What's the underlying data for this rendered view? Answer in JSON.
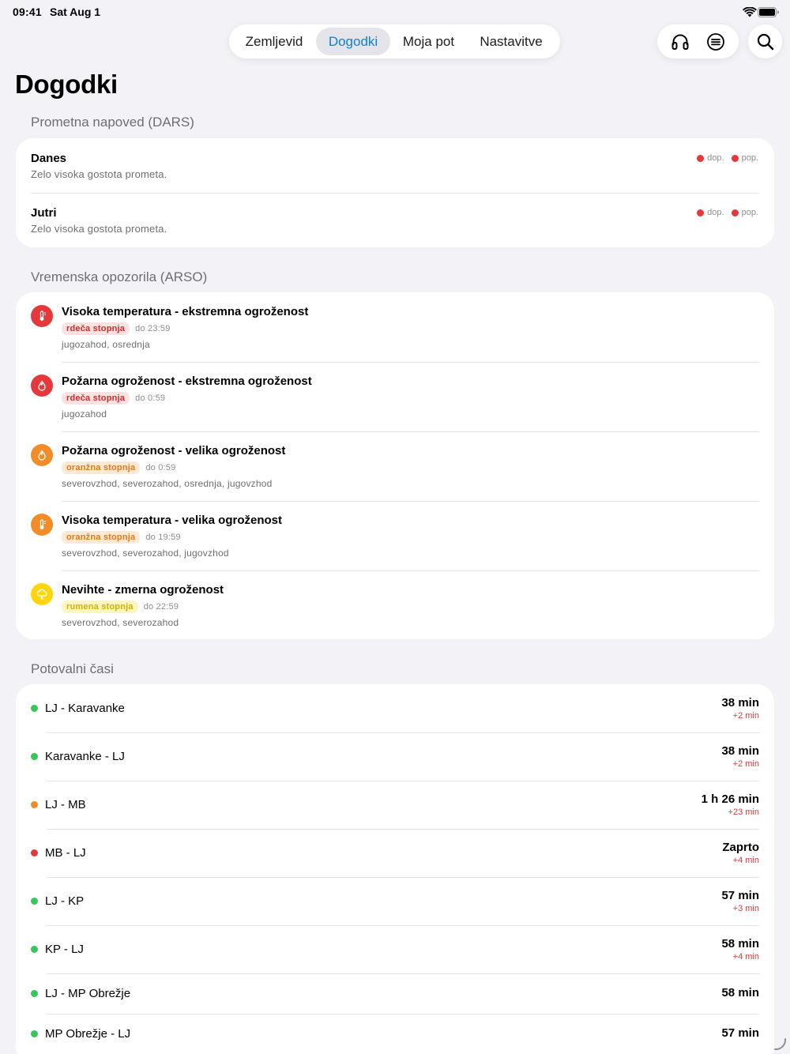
{
  "status_bar": {
    "time": "09:41",
    "date": "Sat Aug 1"
  },
  "nav": {
    "tabs": [
      {
        "label": "Zemljevid",
        "selected": false
      },
      {
        "label": "Dogodki",
        "selected": true
      },
      {
        "label": "Moja pot",
        "selected": false
      },
      {
        "label": "Nastavitve",
        "selected": false
      }
    ],
    "actions": [
      "headphones-icon",
      "list-icon",
      "search-icon"
    ]
  },
  "page": {
    "title": "Dogodki"
  },
  "colors": {
    "accent": "#0a84d8",
    "red": "#e5383b",
    "orange": "#f28c28",
    "yellow": "#ffd60a",
    "green": "#34c759"
  },
  "forecast": {
    "title": "Prometna napoved (DARS)",
    "legend": {
      "morning": "dop.",
      "afternoon": "pop."
    },
    "days": [
      {
        "day": "Danes",
        "description": "Zelo visoka gostota prometa."
      },
      {
        "day": "Jutri",
        "description": "Zelo visoka gostota prometa."
      }
    ]
  },
  "warnings": {
    "title": "Vremenska opozorila (ARSO)",
    "items": [
      {
        "title": "Visoka temperatura - ekstremna ogroženost",
        "level": "rdeča stopnja",
        "until": "do 23:59",
        "regions": "jugozahod, osrednja",
        "icon": "thermometer-icon"
      },
      {
        "title": "Požarna ogroženost - ekstremna ogroženost",
        "level": "rdeča stopnja",
        "until": "do 0:59",
        "regions": "jugozahod",
        "icon": "fire-icon"
      },
      {
        "title": "Požarna ogroženost - velika ogroženost",
        "level": "oranžna stopnja",
        "until": "do 0:59",
        "regions": "severovzhod, severozahod, osrednja, jugovzhod",
        "icon": "fire-icon"
      },
      {
        "title": "Visoka temperatura - velika ogroženost",
        "level": "oranžna stopnja",
        "until": "do 19:59",
        "regions": "severovzhod, severozahod, jugovzhod",
        "icon": "thermometer-icon"
      },
      {
        "title": "Nevihte - zmerna ogroženost",
        "level": "rumena stopnja",
        "until": "do 22:59",
        "regions": "severovzhod, severozahod",
        "icon": "storm-cloud-icon"
      }
    ]
  },
  "travel": {
    "title": "Potovalni časi",
    "routes": [
      {
        "name": "LJ - Karavanke",
        "time": "38 min",
        "delay": "+2 min",
        "status": "green"
      },
      {
        "name": "Karavanke - LJ",
        "time": "38 min",
        "delay": "+2 min",
        "status": "green"
      },
      {
        "name": "LJ - MB",
        "time": "1 h 26 min",
        "delay": "+23 min",
        "status": "orange"
      },
      {
        "name": "MB - LJ",
        "time": "Zaprto",
        "delay": "+4 min",
        "status": "red"
      },
      {
        "name": "LJ - KP",
        "time": "57 min",
        "delay": "+3 min",
        "status": "green"
      },
      {
        "name": "KP - LJ",
        "time": "58 min",
        "delay": "+4 min",
        "status": "green"
      },
      {
        "name": "LJ - MP Obrežje",
        "time": "58 min",
        "delay": "",
        "status": "green"
      },
      {
        "name": "MP Obrežje - LJ",
        "time": "57 min",
        "delay": "",
        "status": "green"
      }
    ]
  }
}
